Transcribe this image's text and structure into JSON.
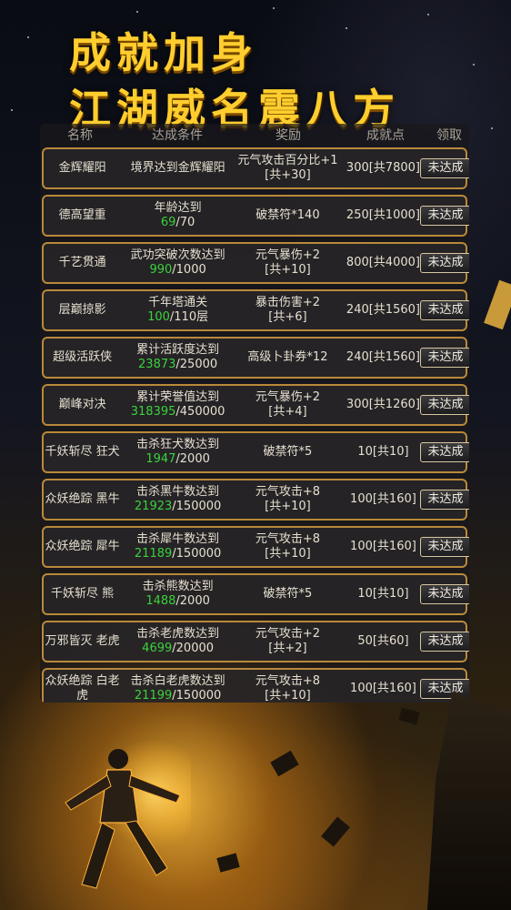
{
  "title": {
    "line1": "成就加身",
    "line2": "江湖威名震八方"
  },
  "header": {
    "name": "名称",
    "condition": "达成条件",
    "reward": "奖励",
    "points": "成就点",
    "claim": "领取"
  },
  "rows": [
    {
      "name": "金辉耀阳",
      "cond_text": "境界达到金辉耀阳",
      "cond_cur": "",
      "cond_max": "",
      "reward1": "元气攻击百分比+1",
      "reward2": "[共+30]",
      "points": "300[共7800]",
      "button": "未达成"
    },
    {
      "name": "德高望重",
      "cond_text": "年龄达到",
      "cond_cur": "69",
      "cond_max": "/70",
      "reward1": "破禁符*140",
      "reward2": "",
      "points": "250[共1000]",
      "button": "未达成"
    },
    {
      "name": "千艺贯通",
      "cond_text": "武功突破次数达到",
      "cond_cur": "990",
      "cond_max": "/1000",
      "reward1": "元气暴伤+2",
      "reward2": "[共+10]",
      "points": "800[共4000]",
      "button": "未达成"
    },
    {
      "name": "层巅掠影",
      "cond_text": "千年塔通关",
      "cond_cur": "100",
      "cond_max": "/110层",
      "reward1": "暴击伤害+2",
      "reward2": "[共+6]",
      "points": "240[共1560]",
      "button": "未达成"
    },
    {
      "name": "超级活跃侠",
      "cond_text": "累计活跃度达到",
      "cond_cur": "23873",
      "cond_max": "/25000",
      "reward1": "高级卜卦券*12",
      "reward2": "",
      "points": "240[共1560]",
      "button": "未达成"
    },
    {
      "name": "巅峰对决",
      "cond_text": "累计荣誉值达到",
      "cond_cur": "318395",
      "cond_max": "/450000",
      "reward1": "元气暴伤+2",
      "reward2": "[共+4]",
      "points": "300[共1260]",
      "button": "未达成"
    },
    {
      "name": "千妖斩尽 狂犬",
      "cond_text": "击杀狂犬数达到",
      "cond_cur": "1947",
      "cond_max": "/2000",
      "reward1": "破禁符*5",
      "reward2": "",
      "points": "10[共10]",
      "button": "未达成"
    },
    {
      "name": "众妖绝踪 黑牛",
      "cond_text": "击杀黑牛数达到",
      "cond_cur": "21923",
      "cond_max": "/150000",
      "reward1": "元气攻击+8",
      "reward2": "[共+10]",
      "points": "100[共160]",
      "button": "未达成"
    },
    {
      "name": "众妖绝踪 犀牛",
      "cond_text": "击杀犀牛数达到",
      "cond_cur": "21189",
      "cond_max": "/150000",
      "reward1": "元气攻击+8",
      "reward2": "[共+10]",
      "points": "100[共160]",
      "button": "未达成"
    },
    {
      "name": "千妖斩尽 熊",
      "cond_text": "击杀熊数达到",
      "cond_cur": "1488",
      "cond_max": "/2000",
      "reward1": "破禁符*5",
      "reward2": "",
      "points": "10[共10]",
      "button": "未达成"
    },
    {
      "name": "万邪皆灭 老虎",
      "cond_text": "击杀老虎数达到",
      "cond_cur": "4699",
      "cond_max": "/20000",
      "reward1": "元气攻击+2",
      "reward2": "[共+2]",
      "points": "50[共60]",
      "button": "未达成"
    },
    {
      "name": "众妖绝踪 白老虎",
      "cond_text": "击杀白老虎数达到",
      "cond_cur": "21199",
      "cond_max": "/150000",
      "reward1": "元气攻击+8",
      "reward2": "[共+10]",
      "points": "100[共160]",
      "button": "未达成"
    }
  ]
}
